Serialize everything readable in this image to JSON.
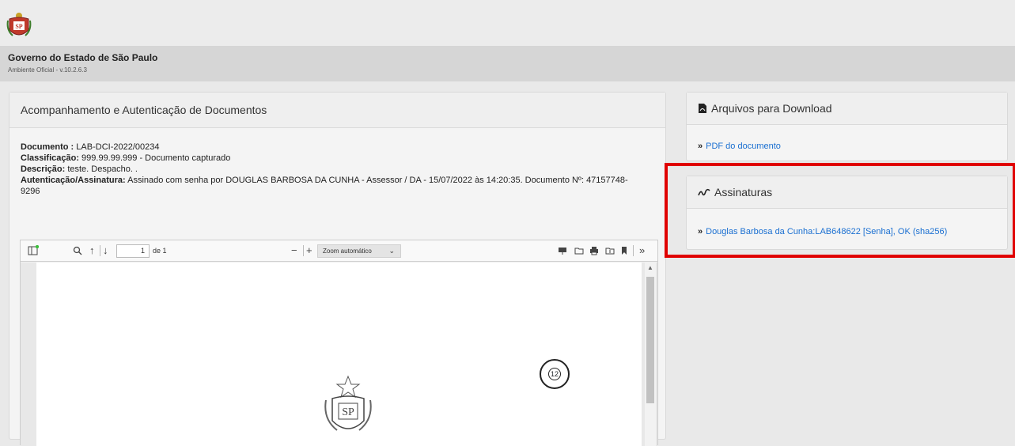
{
  "header": {
    "logo_icon": "sao-paulo-crest-icon",
    "title": "Governo do Estado de São Paulo",
    "subtitle": "Ambiente Oficial - v.10.2.6.3"
  },
  "main": {
    "title": "Acompanhamento e Autenticação de Documentos",
    "documento_label": "Documento :",
    "documento_value": " LAB-DCI-2022/00234",
    "classificacao_label": "Classificação:",
    "classificacao_value": " 999.99.99.999 - Documento capturado",
    "descricao_label": "Descrição:",
    "descricao_value": " teste. Despacho. .",
    "autenticacao_label": "Autenticação/Assinatura:",
    "autenticacao_value": " Assinado com senha por DOUGLAS BARBOSA DA CUNHA - Assessor / DA - 15/07/2022 às 14:20:35. Documento Nº: 47157748-9296"
  },
  "viewer": {
    "page_value": "1",
    "page_count": "de 1",
    "zoom": "Zoom automático",
    "stamp_number": "12"
  },
  "downloads": {
    "title": "Arquivos para Download",
    "link": "PDF do documento"
  },
  "signatures": {
    "title": "Assinaturas",
    "link": "Douglas Barbosa da Cunha:LAB648622 [Senha], OK (sha256)"
  },
  "colors": {
    "link": "#1a6fd1",
    "highlight": "#e00000"
  }
}
